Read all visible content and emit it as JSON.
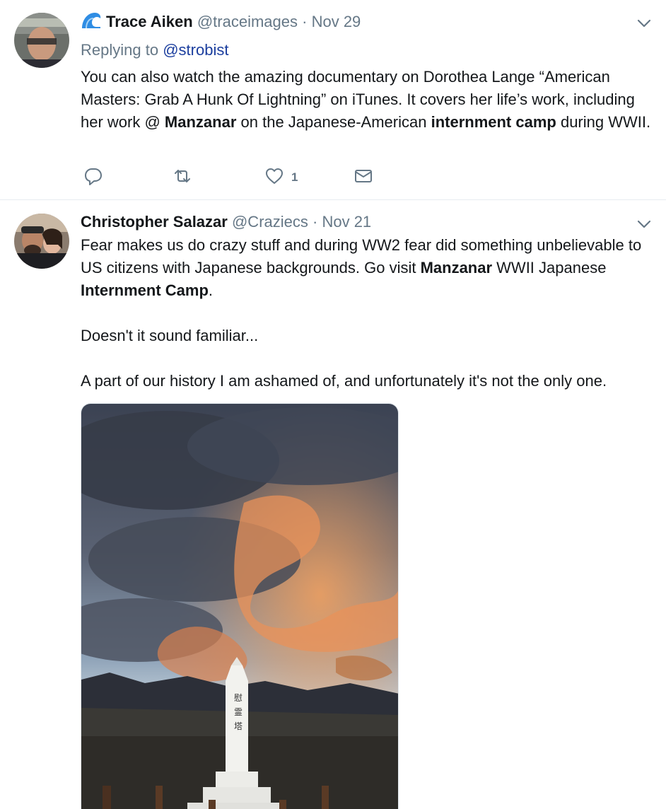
{
  "tweets": [
    {
      "name": "Trace Aiken",
      "handle": "@traceimages",
      "separator": "·",
      "date": "Nov 29",
      "badge_icon": "wave-icon",
      "replying_prefix": "Replying to",
      "replying_to": "@strobist",
      "text_parts": [
        "You can also watch the amazing documentary on Dorothea Lange “American Masters: Grab A Hunk Of Lightning” on iTunes. It covers her life’s work, including her work @ ",
        "Manzanar",
        " on the Japanese-American ",
        "internment camp",
        " during WWII."
      ],
      "actions": {
        "reply_icon": "reply-icon",
        "retweet_icon": "retweet-icon",
        "like_icon": "heart-icon",
        "like_count": "1",
        "dm_icon": "envelope-icon"
      }
    },
    {
      "name": "Christopher Salazar",
      "handle": "@Craziecs",
      "separator": "·",
      "date": "Nov 21",
      "p1_parts": [
        "Fear makes us do crazy stuff and during WW2 fear did something unbelievable to US citizens with Japanese backgrounds. Go visit ",
        "Manzanar",
        " WWII Japanese ",
        "Internment Camp",
        "."
      ],
      "p2": "Doesn't it sound familiar...",
      "p3": "A part of our history I am ashamed of, and unfortunately it's not the only one.",
      "media_description_icon": "photo-manzanar-monument"
    }
  ],
  "colors": {
    "text": "#14171a",
    "secondary": "#657786",
    "link": "#1b3e9e",
    "divider": "#e6ecf0"
  }
}
